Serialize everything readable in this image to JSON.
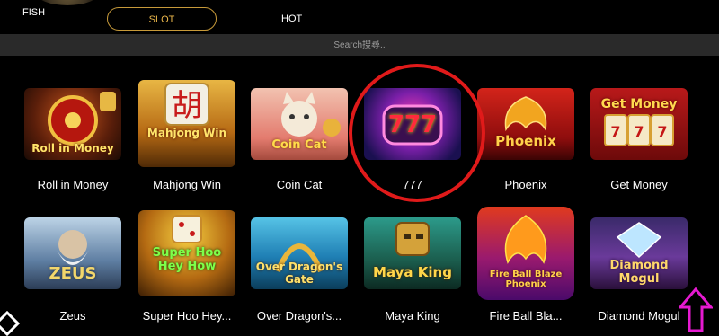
{
  "tabs": [
    {
      "label": "FISH"
    },
    {
      "label": "SLOT",
      "active": true
    },
    {
      "label": "HOT"
    }
  ],
  "search": {
    "placeholder": "Search搜尋.."
  },
  "games": [
    {
      "title": "Roll in Money",
      "art": "Roll in Money"
    },
    {
      "title": "Mahjong Win",
      "art": "Mahjong Win"
    },
    {
      "title": "Coin Cat",
      "art": "Coin Cat"
    },
    {
      "title": "777",
      "art": "777"
    },
    {
      "title": "Phoenix",
      "art": "Phoenix"
    },
    {
      "title": "Get Money",
      "art": "Get Money"
    },
    {
      "title": "Zeus",
      "art": "ZEUS"
    },
    {
      "title": "Super Hoo Hey...",
      "art": "Super Hoo Hey How"
    },
    {
      "title": "Over Dragon's...",
      "art": "Over Dragon's Gate"
    },
    {
      "title": "Maya King",
      "art": "Maya King"
    },
    {
      "title": "Fire Ball Bla...",
      "art": "Fire Ball Blaze Phoenix"
    },
    {
      "title": "Diamond Mogul",
      "art": "Diamond Mogul"
    }
  ],
  "colors": {
    "accent": "#c79a3a",
    "highlight_circle": "#e01a1a",
    "arrow": "#e61ad1"
  },
  "icons": {
    "scroll_top": "up-arrow-icon"
  }
}
